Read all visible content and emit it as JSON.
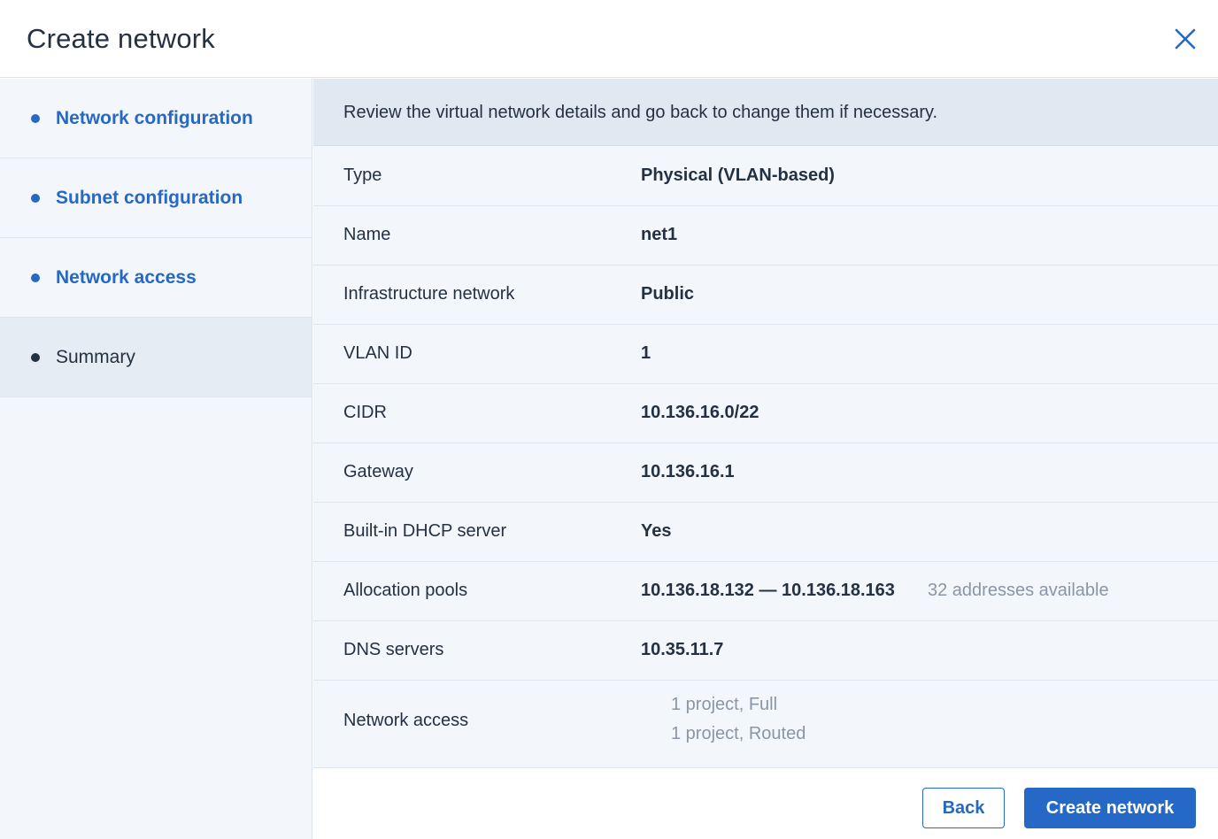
{
  "dialog": {
    "title": "Create network",
    "close_icon": "close-icon"
  },
  "sidebar": {
    "steps": [
      {
        "label": "Network configuration",
        "state": "completed"
      },
      {
        "label": "Subnet configuration",
        "state": "completed"
      },
      {
        "label": "Network access",
        "state": "completed"
      },
      {
        "label": "Summary",
        "state": "active"
      }
    ]
  },
  "banner": {
    "text": "Review the virtual network details and go back to change them if necessary."
  },
  "summary": {
    "type": {
      "key": "Type",
      "value": "Physical (VLAN-based)"
    },
    "name": {
      "key": "Name",
      "value": "net1"
    },
    "infrastructure": {
      "key": "Infrastructure network",
      "value": "Public"
    },
    "vlan": {
      "key": "VLAN ID",
      "value": "1"
    },
    "cidr": {
      "key": "CIDR",
      "value": "10.136.16.0/22"
    },
    "gateway": {
      "key": "Gateway",
      "value": "10.136.16.1"
    },
    "dhcp": {
      "key": "Built-in DHCP server",
      "value": "Yes"
    },
    "pools": {
      "key": "Allocation pools",
      "value": "10.136.18.132 — 10.136.18.163",
      "hint": "32 addresses available"
    },
    "dns": {
      "key": "DNS servers",
      "value": "10.35.11.7"
    },
    "access": {
      "key": "Network access",
      "lines": [
        "1 project, Full",
        "1 project, Routed"
      ]
    }
  },
  "footer": {
    "back_label": "Back",
    "create_label": "Create network"
  },
  "colors": {
    "accent": "#2668c5",
    "text": "#243143",
    "muted": "#8a96a6",
    "panel": "#f3f6fa",
    "banner": "#e0e8f2"
  }
}
